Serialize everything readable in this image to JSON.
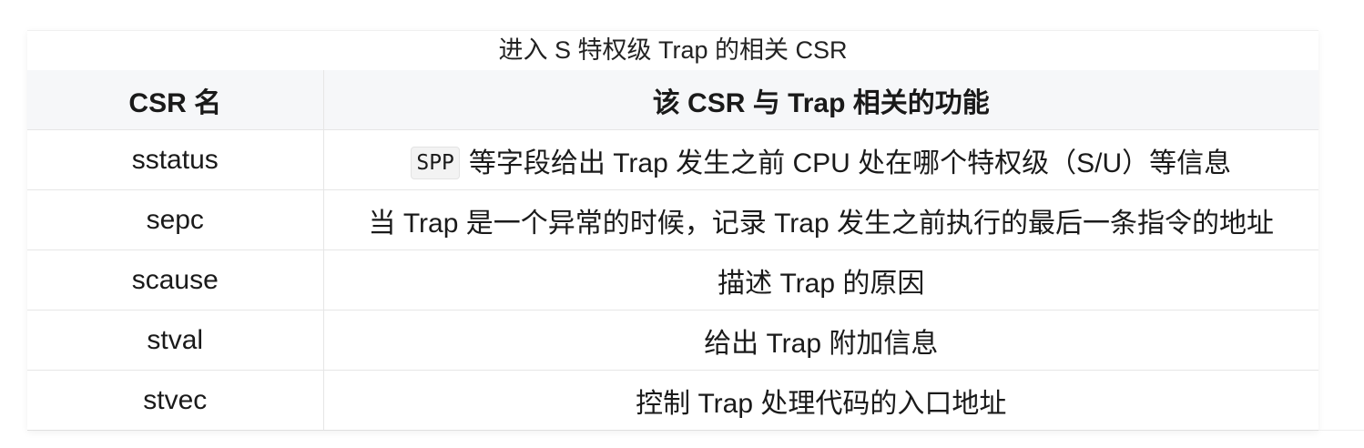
{
  "table": {
    "caption": "进入 S 特权级 Trap 的相关 CSR",
    "headers": [
      "CSR 名",
      "该 CSR 与 Trap 相关的功能"
    ],
    "rows": [
      {
        "name": "sstatus",
        "code": "SPP",
        "desc": "等字段给出 Trap 发生之前 CPU 处在哪个特权级（S/U）等信息"
      },
      {
        "name": "sepc",
        "desc": "当 Trap 是一个异常的时候，记录 Trap 发生之前执行的最后一条指令的地址"
      },
      {
        "name": "scause",
        "desc": "描述 Trap 的原因"
      },
      {
        "name": "stval",
        "desc": "给出 Trap 附加信息"
      },
      {
        "name": "stvec",
        "desc": "控制 Trap 处理代码的入口地址"
      }
    ]
  }
}
